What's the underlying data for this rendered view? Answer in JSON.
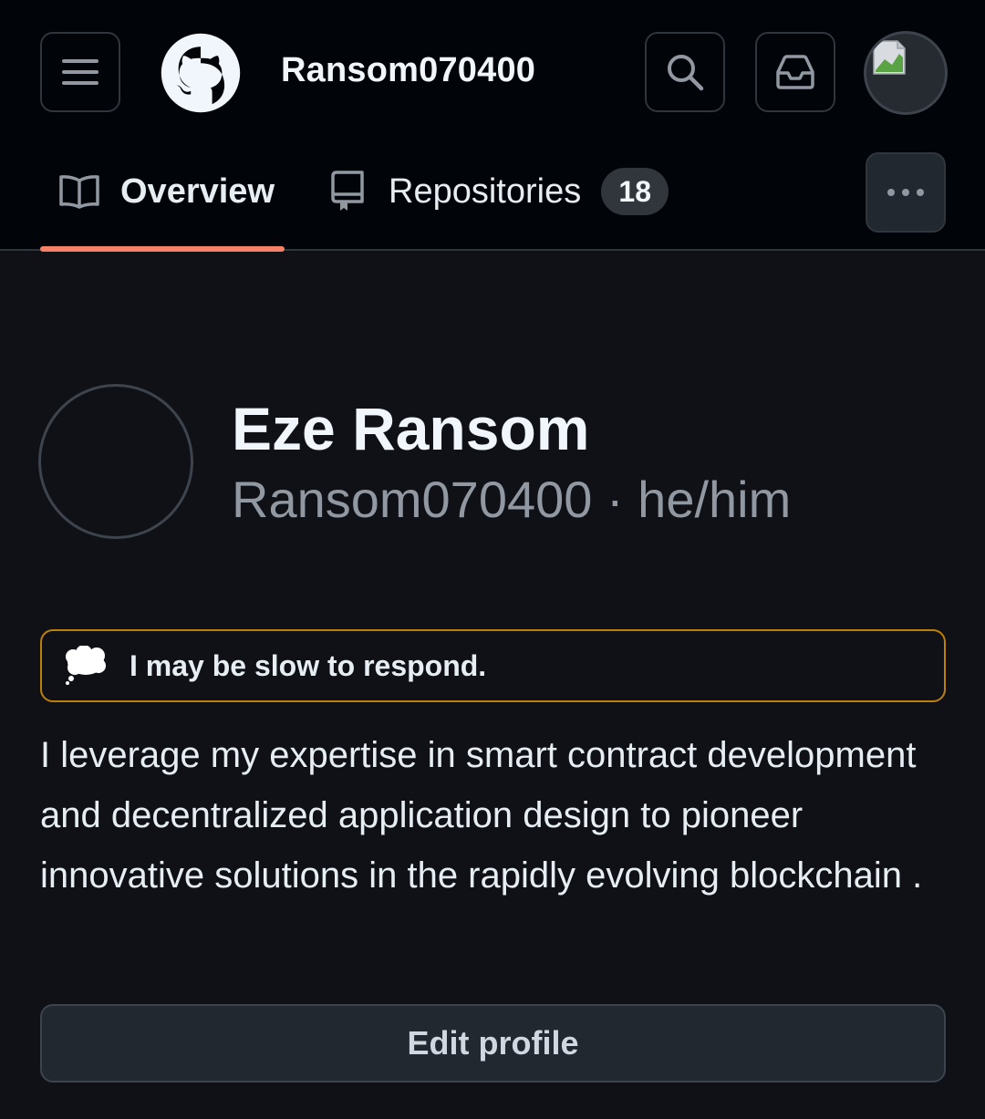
{
  "header": {
    "username": "Ransom070400",
    "icons": {
      "menu": "hamburger-menu-icon",
      "logo": "github-octocat-logo",
      "search": "search-icon",
      "inbox": "inbox-icon",
      "avatar": "broken-image-avatar"
    }
  },
  "tabs": [
    {
      "label": "Overview",
      "icon": "book-icon",
      "active": true
    },
    {
      "label": "Repositories",
      "icon": "repo-icon",
      "count": "18"
    }
  ],
  "profile": {
    "full_name": "Eze Ransom",
    "handle": "Ransom070400",
    "separator": "·",
    "pronouns": "he/him",
    "status": {
      "emoji": "thought-balloon",
      "text": "I may be slow to respond."
    },
    "bio": "I leverage my expertise in smart contract development and decentralized application design to pioneer innovative solutions in the rapidly evolving blockchain .",
    "edit_button_label": "Edit profile"
  },
  "colors": {
    "page_bg": "#0f1117",
    "header_bg": "#010409",
    "tab_underline": "#f78166",
    "status_border": "#bb8009",
    "muted_text": "#9198a1"
  }
}
